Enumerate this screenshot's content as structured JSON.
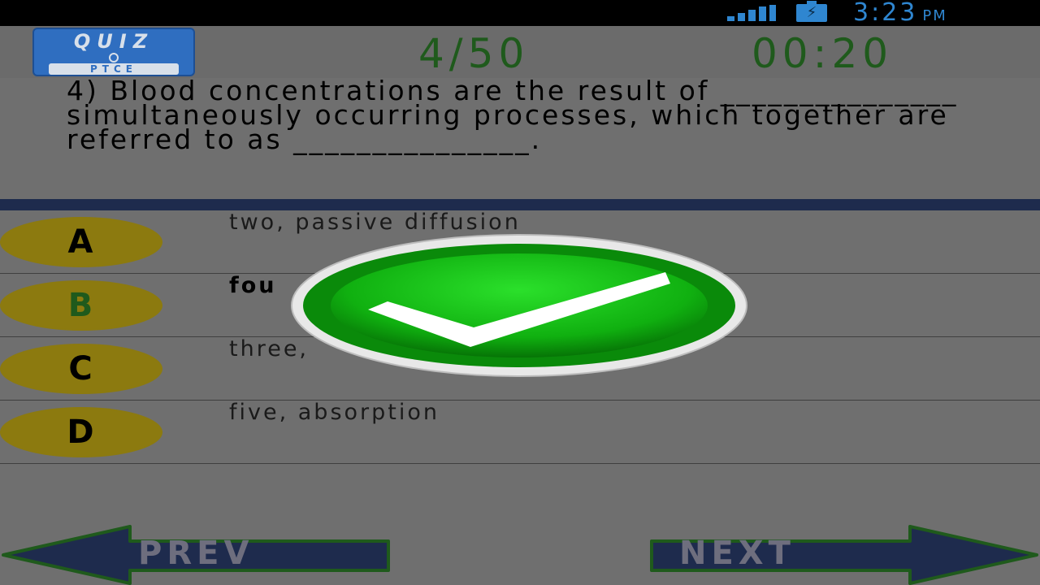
{
  "status_bar": {
    "time": "3:23",
    "ampm": "PM",
    "signal_icon": "signal-bars-icon",
    "battery_icon": "battery-charging-icon",
    "color": "#2f86d0"
  },
  "header": {
    "logo": {
      "top_text": "QUIZ",
      "bottom_text": "PTCE"
    },
    "counter": "4/50",
    "timer": "00:20"
  },
  "question": {
    "text": "4) Blood concentrations are the result of _______________ simultaneously occurring processes, which together are referred to as _______________."
  },
  "options": [
    {
      "letter": "A",
      "text": "two, passive diffusion",
      "correct": false
    },
    {
      "letter": "B",
      "text": "fou",
      "correct": true
    },
    {
      "letter": "C",
      "text": "three,",
      "correct": false
    },
    {
      "letter": "D",
      "text": "five, absorption",
      "correct": false
    }
  ],
  "navigation": {
    "prev_label": "PREV",
    "next_label": "NEXT"
  },
  "feedback": {
    "icon": "green-checkmark-icon",
    "color": "#1fbf1f"
  },
  "colors": {
    "text_green": "#1f5a1c",
    "option_oval": "#8c7a0f",
    "divider": "#1e2b4d",
    "nav_arrow": "#1e2b4d"
  }
}
